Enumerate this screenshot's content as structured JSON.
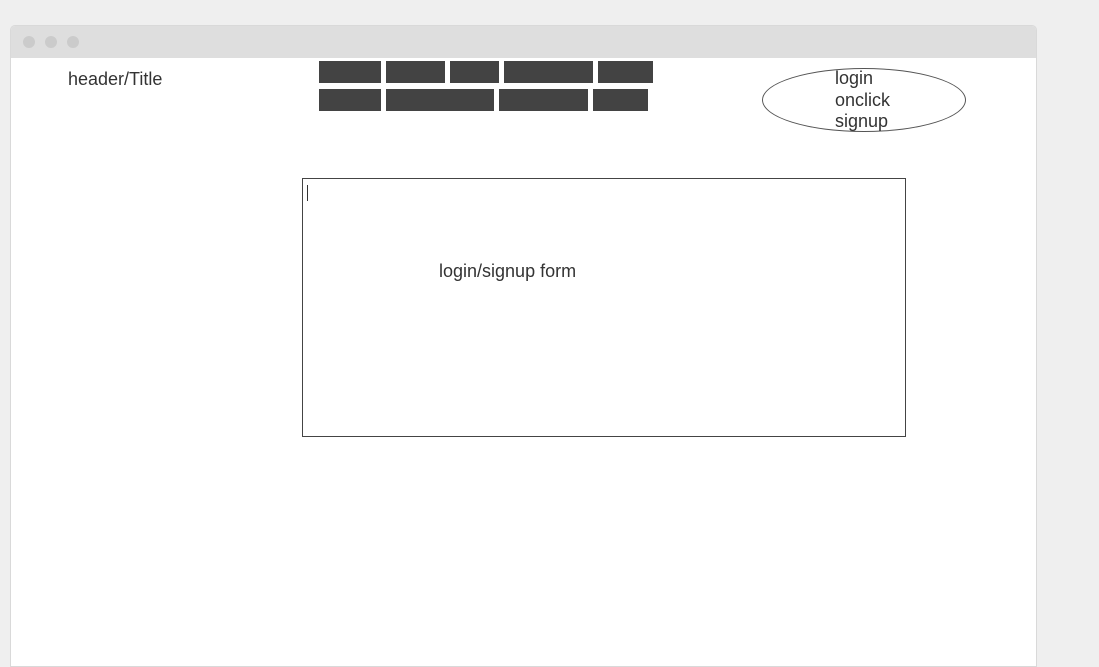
{
  "header": {
    "title": "header/Title"
  },
  "nav": {
    "items": [
      {
        "label": ""
      },
      {
        "label": ""
      },
      {
        "label": ""
      },
      {
        "label": ""
      },
      {
        "label": ""
      },
      {
        "label": ""
      },
      {
        "label": ""
      },
      {
        "label": ""
      },
      {
        "label": ""
      }
    ]
  },
  "login_button": {
    "line1": "login",
    "line2": "onclick",
    "line3": "signup"
  },
  "form": {
    "label": "login/signup form"
  },
  "colors": {
    "page_bg": "#efefef",
    "titlebar": "#dedede",
    "nav_block": "#434343",
    "text": "#333333"
  }
}
